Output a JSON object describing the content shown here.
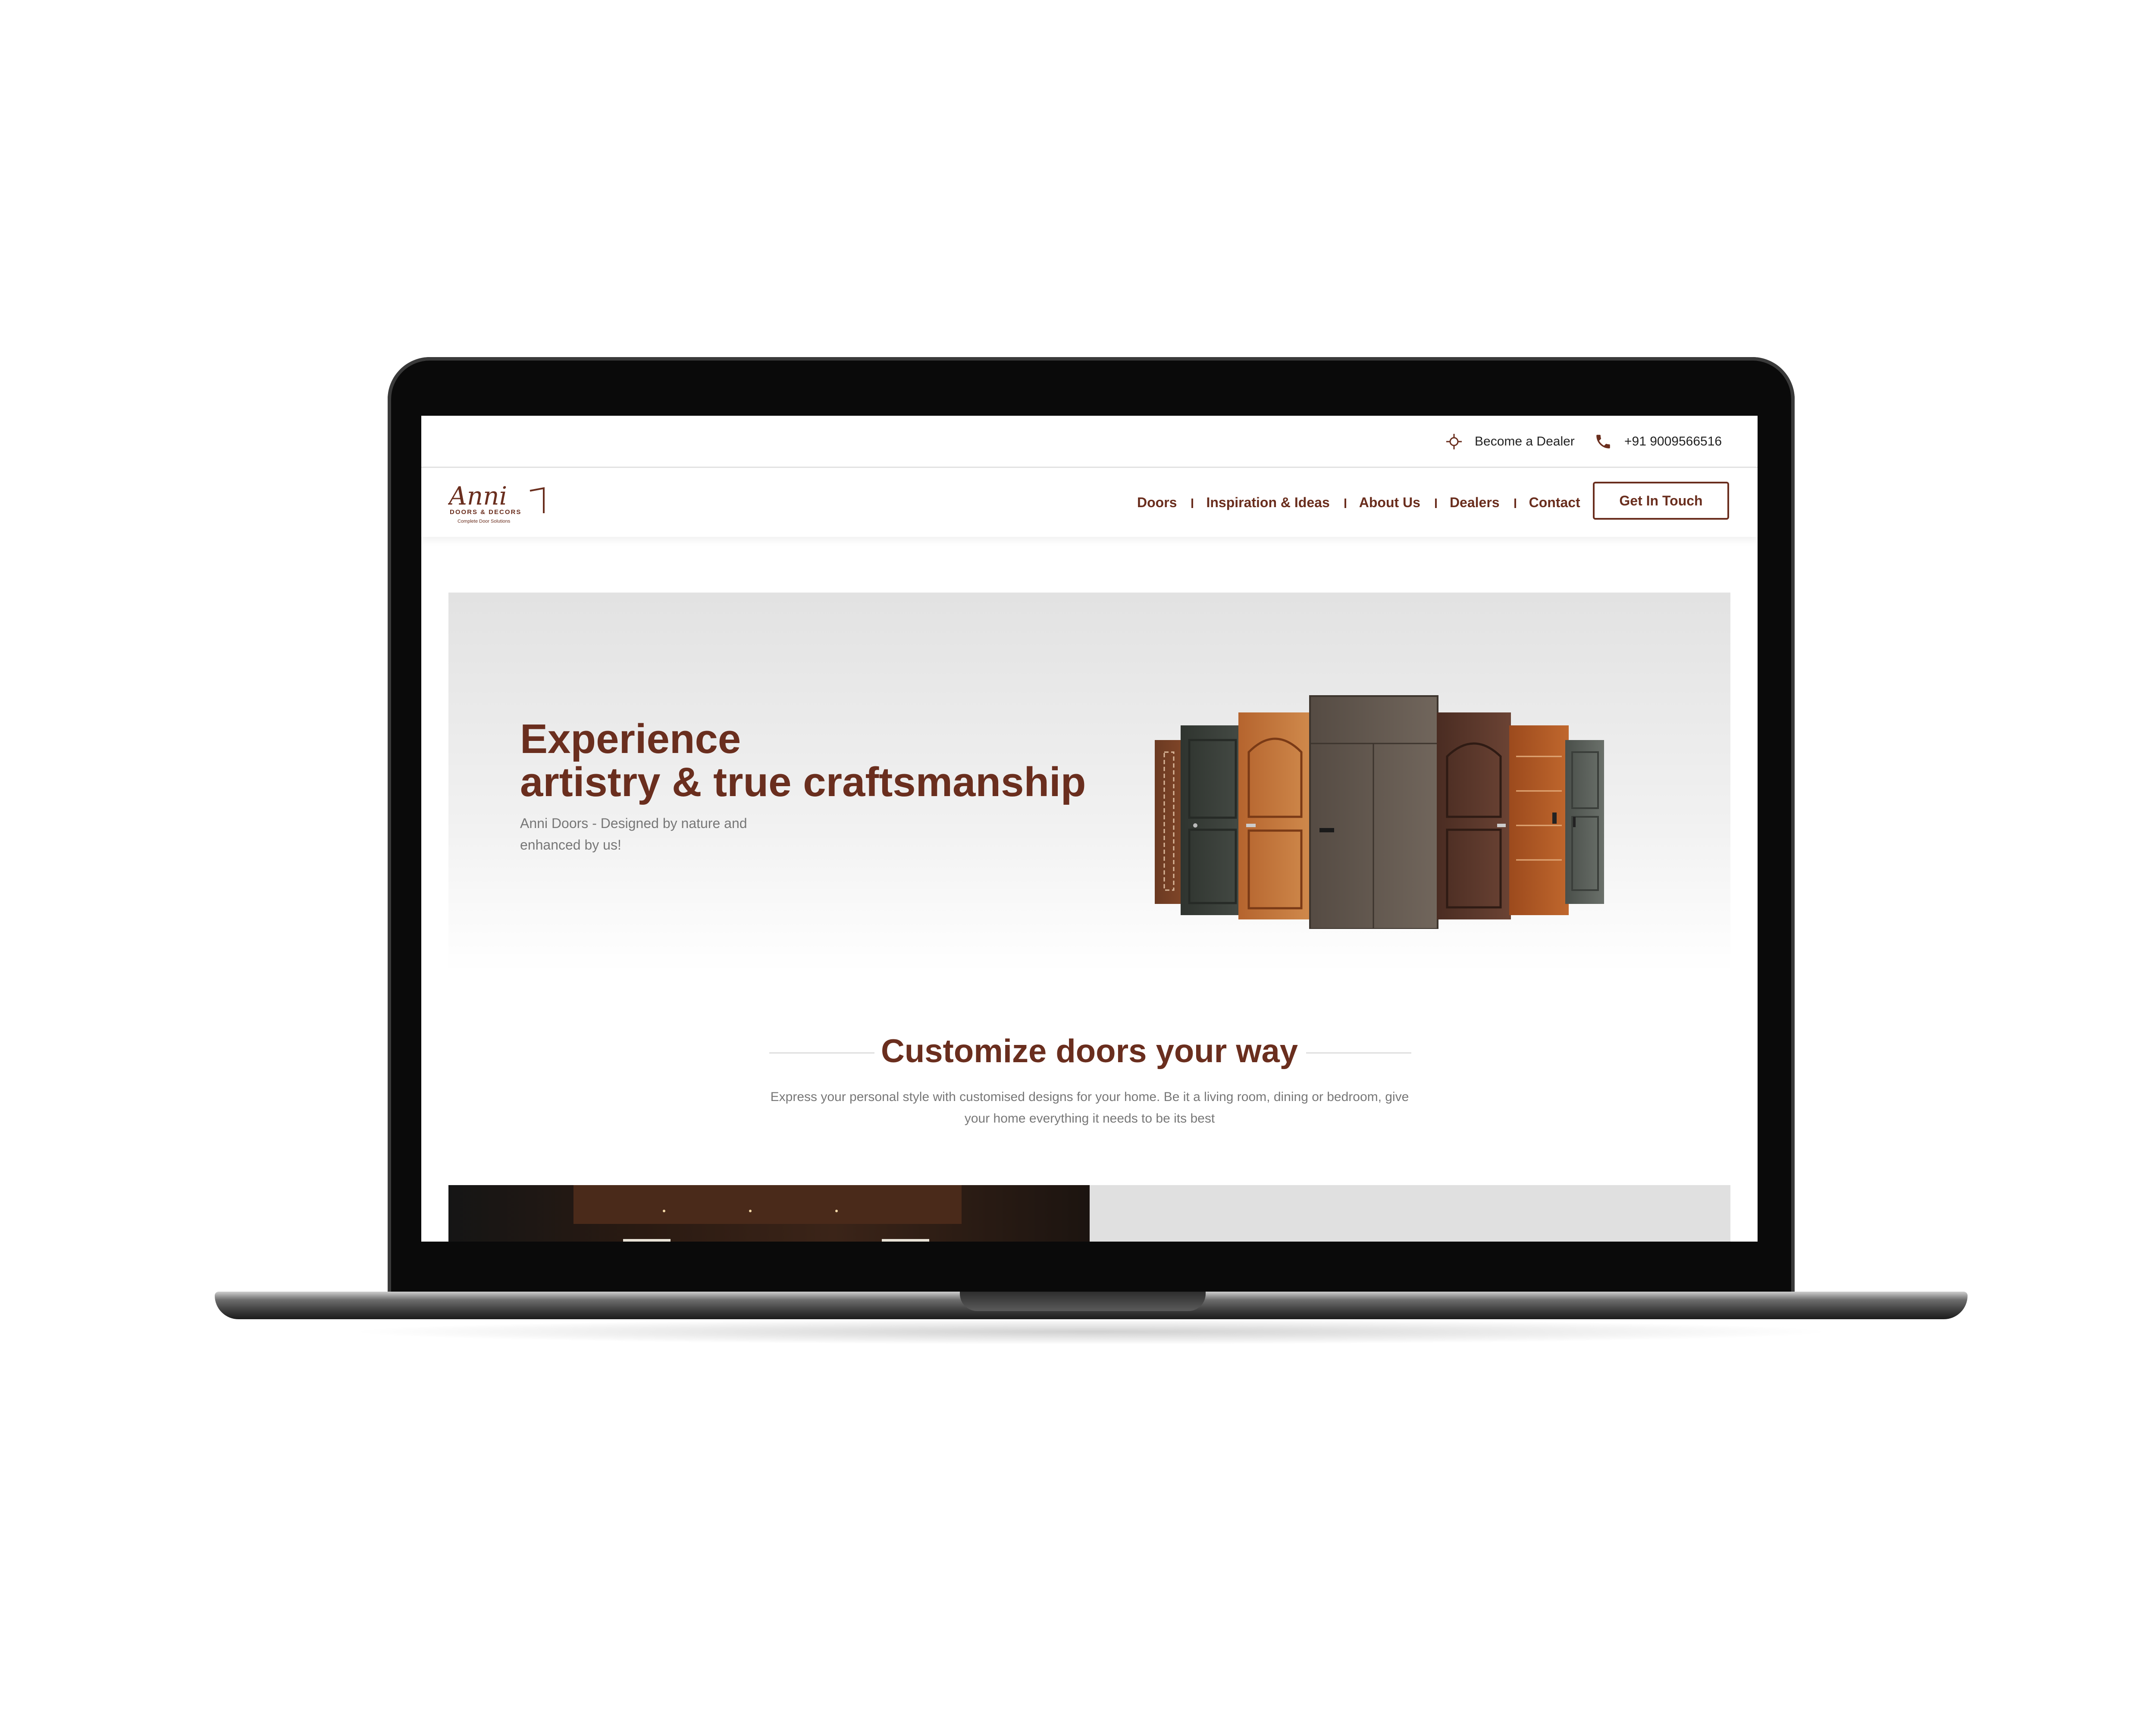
{
  "topbar": {
    "become_dealer": "Become a Dealer",
    "phone": "+91 9009566516"
  },
  "brand": {
    "name": "Anni",
    "tagline": "DOORS & DECORS",
    "subtagline": "Complete Door Solutions",
    "color": "#6a2e1e"
  },
  "nav": {
    "items": [
      "Doors",
      "Inspiration & Ideas",
      "About Us",
      "Dealers",
      "Contact"
    ],
    "cta": "Get In Touch"
  },
  "hero": {
    "title_line1": "Experience",
    "title_line2": "artistry & true craftsmanship",
    "subtitle_line1": "Anni Doors - Designed by nature and",
    "subtitle_line2": "enhanced by us!"
  },
  "customize": {
    "title": "Customize doors your way",
    "desc_line1": "Express your personal style with customised designs for your home. Be it a living room, dining or bedroom, give",
    "desc_line2": "your home everything it needs to be its best"
  }
}
